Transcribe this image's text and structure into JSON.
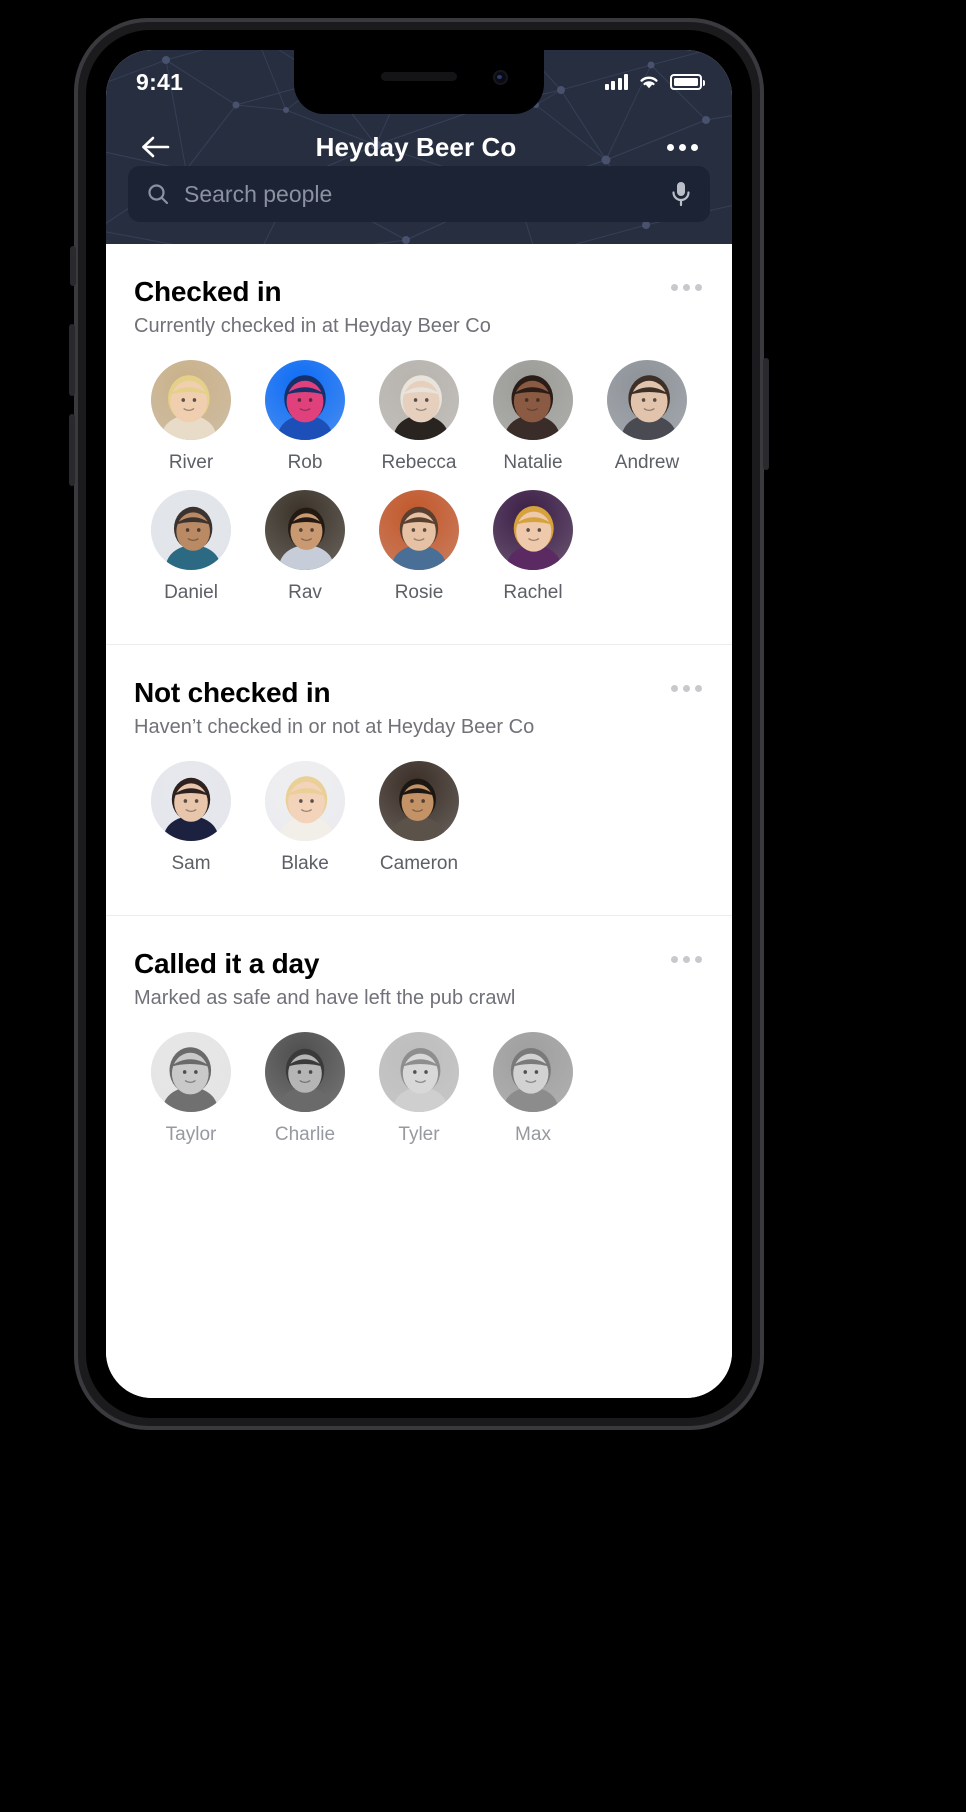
{
  "status_bar": {
    "time": "9:41",
    "signal_icon": "cellular-signal-icon",
    "wifi_icon": "wifi-icon",
    "battery_icon": "battery-full-icon"
  },
  "nav": {
    "back_icon": "arrow-left-icon",
    "title": "Heyday Beer Co",
    "more_icon": "more-horizontal-icon"
  },
  "search": {
    "icon": "search-icon",
    "placeholder": "Search people",
    "value": "",
    "mic_icon": "microphone-icon"
  },
  "theme": {
    "header_bg": "#272e40",
    "search_bg": "#1c2334",
    "content_bg": "#ffffff",
    "title_color": "#000000",
    "subtitle_color": "#6f7278",
    "name_color": "#5c5f66",
    "muted_name_color": "#96999f",
    "menu_dot_color": "#c9c9cd"
  },
  "sections": [
    {
      "id": "checked-in",
      "title": "Checked in",
      "subtitle": "Currently checked in at Heyday Beer Co",
      "menu_icon": "more-horizontal-icon",
      "muted": false,
      "people": [
        {
          "name": "River",
          "avatar": "blonde-woman-smiling"
        },
        {
          "name": "Rob",
          "avatar": "man-blue-neon-cap"
        },
        {
          "name": "Rebecca",
          "avatar": "woman-beanie-winter"
        },
        {
          "name": "Natalie",
          "avatar": "woman-glasses-curly"
        },
        {
          "name": "Andrew",
          "avatar": "man-beard-grey-bg"
        },
        {
          "name": "Daniel",
          "avatar": "man-curly-sunglasses"
        },
        {
          "name": "Rav",
          "avatar": "man-beard-dark-bg"
        },
        {
          "name": "Rosie",
          "avatar": "woman-denim-orange-bg"
        },
        {
          "name": "Rachel",
          "avatar": "woman-curly-blonde-purple-bg"
        }
      ]
    },
    {
      "id": "not-checked-in",
      "title": "Not checked in",
      "subtitle": "Haven’t checked in or not at Heyday Beer Co",
      "menu_icon": "more-horizontal-icon",
      "muted": false,
      "people": [
        {
          "name": "Sam",
          "avatar": "woman-dark-hair-navy-top"
        },
        {
          "name": "Blake",
          "avatar": "woman-blonde-tiara"
        },
        {
          "name": "Cameron",
          "avatar": "woman-dark-hair-patterned-top"
        }
      ]
    },
    {
      "id": "called-it-a-day",
      "title": "Called it a day",
      "subtitle": "Marked as safe and have left the pub crawl",
      "menu_icon": "more-horizontal-icon",
      "muted": true,
      "people": [
        {
          "name": "Taylor",
          "avatar": "man-glasses-beard-light-bg"
        },
        {
          "name": "Charlie",
          "avatar": "man-short-hair-dark-bg"
        },
        {
          "name": "Tyler",
          "avatar": "woman-turtleneck"
        },
        {
          "name": "Max",
          "avatar": "woman-smiling-outdoors"
        }
      ]
    }
  ]
}
